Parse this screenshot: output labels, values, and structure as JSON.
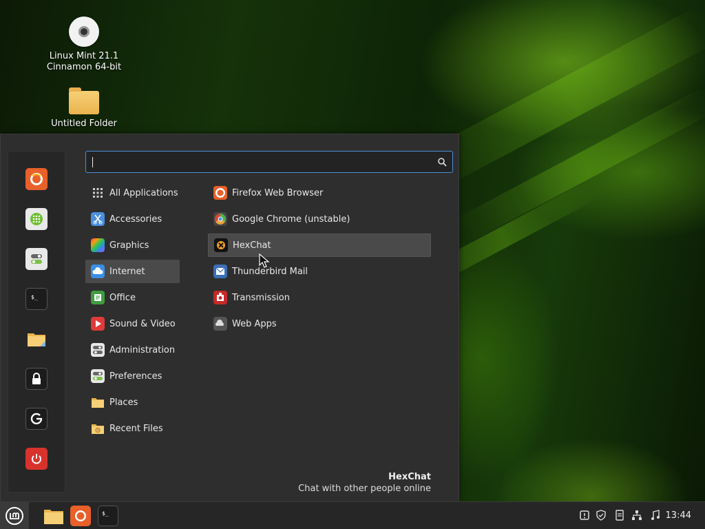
{
  "desktop": {
    "icons": [
      {
        "label_line1": "Linux Mint 21.1",
        "label_line2": "Cinnamon 64-bit",
        "icon": "disc-icon"
      },
      {
        "label_line1": "Untitled Folder",
        "label_line2": "",
        "icon": "folder-icon"
      }
    ]
  },
  "menu": {
    "search": {
      "value": "",
      "placeholder": ""
    },
    "favorites": [
      "firefox-icon",
      "software-manager-icon",
      "settings-toggle-icon",
      "terminal-icon",
      "files-folder-icon",
      "lock-icon",
      "logout-icon",
      "power-icon"
    ],
    "categories": [
      {
        "label": "All Applications",
        "icon": "grid-icon"
      },
      {
        "label": "Accessories",
        "icon": "scissors-icon"
      },
      {
        "label": "Graphics",
        "icon": "graphics-icon"
      },
      {
        "label": "Internet",
        "icon": "cloud-icon"
      },
      {
        "label": "Office",
        "icon": "office-icon"
      },
      {
        "label": "Sound & Video",
        "icon": "play-icon"
      },
      {
        "label": "Administration",
        "icon": "admin-toggle-icon"
      },
      {
        "label": "Preferences",
        "icon": "preferences-toggle-icon"
      },
      {
        "label": "Places",
        "icon": "folder-icon"
      },
      {
        "label": "Recent Files",
        "icon": "recent-folder-icon"
      }
    ],
    "apps": [
      {
        "label": "Firefox Web Browser",
        "icon": "firefox-icon"
      },
      {
        "label": "Google Chrome (unstable)",
        "icon": "chrome-icon"
      },
      {
        "label": "HexChat",
        "icon": "hexchat-icon"
      },
      {
        "label": "Thunderbird Mail",
        "icon": "mail-icon"
      },
      {
        "label": "Transmission",
        "icon": "transmission-icon"
      },
      {
        "label": "Web Apps",
        "icon": "web-apps-icon"
      }
    ],
    "selected_category": "Internet",
    "hovered_app": "HexChat",
    "description": {
      "title": "HexChat",
      "text": "Chat with other people online"
    }
  },
  "taskbar": {
    "clock": "13:44",
    "launchers": [
      "files-folder-icon",
      "firefox-icon",
      "terminal-icon"
    ],
    "tray": [
      "update-icon",
      "shield-icon",
      "notes-icon",
      "network-icon",
      "music-icon"
    ]
  },
  "colors": {
    "accent": "#4a90d9",
    "menu_bg": "#2e2e2e",
    "taskbar_bg": "#262626",
    "highlight": "#4a4a4a"
  }
}
